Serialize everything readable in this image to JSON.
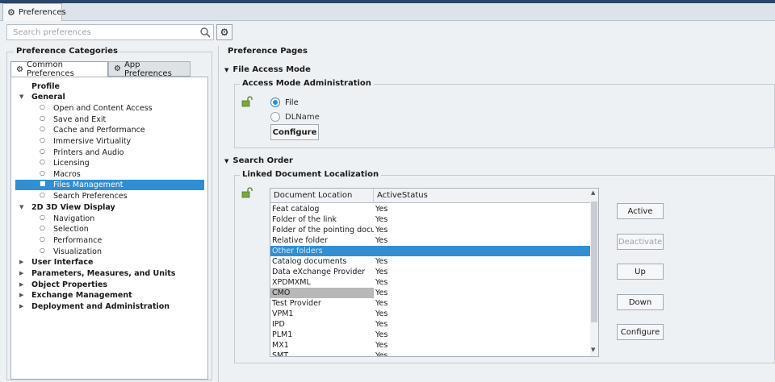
{
  "window": {
    "tab_label": "Preferences"
  },
  "search": {
    "placeholder": "Search preferences",
    "value": ""
  },
  "left": {
    "group_title": "Preference Categories",
    "tabs": [
      {
        "label": "Common Preferences"
      },
      {
        "label": "App Preferences"
      }
    ],
    "tree": [
      {
        "label": "Profile",
        "level": 0,
        "bold": true
      },
      {
        "label": "General",
        "level": 0,
        "bold": true,
        "expanded": true
      },
      {
        "label": "Open and Content Access",
        "level": 1
      },
      {
        "label": "Save and Exit",
        "level": 1
      },
      {
        "label": "Cache and Performance",
        "level": 1
      },
      {
        "label": "Immersive Virtuality",
        "level": 1
      },
      {
        "label": "Printers and Audio",
        "level": 1
      },
      {
        "label": "Licensing",
        "level": 1
      },
      {
        "label": "Macros",
        "level": 1
      },
      {
        "label": "Files Management",
        "level": 1,
        "selected": true
      },
      {
        "label": "Search Preferences",
        "level": 1
      },
      {
        "label": "2D 3D View Display",
        "level": 0,
        "bold": true,
        "expanded": true
      },
      {
        "label": "Navigation",
        "level": 1
      },
      {
        "label": "Selection",
        "level": 1
      },
      {
        "label": "Performance",
        "level": 1
      },
      {
        "label": "Visualization",
        "level": 1
      },
      {
        "label": "User Interface",
        "level": 0,
        "bold": true,
        "collapsed": true
      },
      {
        "label": "Parameters, Measures, and Units",
        "level": 0,
        "bold": true,
        "collapsed": true
      },
      {
        "label": "Object Properties",
        "level": 0,
        "bold": true,
        "collapsed": true
      },
      {
        "label": "Exchange Management",
        "level": 0,
        "bold": true,
        "collapsed": true
      },
      {
        "label": "Deployment and Administration",
        "level": 0,
        "bold": true,
        "collapsed": true
      }
    ]
  },
  "right": {
    "group_title": "Preference Pages",
    "file_access": {
      "title": "File Access Mode",
      "admin_title": "Access Mode Administration",
      "radio_file": "File",
      "radio_dlname": "DLName",
      "selected": "File",
      "configure_label": "Configure"
    },
    "search_order": {
      "title": "Search Order",
      "linked_title": "Linked Document Localization",
      "columns": [
        "Document Location",
        "ActiveStatus"
      ],
      "rows": [
        {
          "location": "Feat catalog",
          "status": "Yes"
        },
        {
          "location": "Folder of the link",
          "status": "Yes"
        },
        {
          "location": "Folder of the pointing docu",
          "status": "Yes"
        },
        {
          "location": "Relative folder",
          "status": "Yes"
        },
        {
          "location": "Other folders",
          "status": "",
          "selected": true
        },
        {
          "location": "Catalog documents",
          "status": "Yes"
        },
        {
          "location": "Data eXchange Provider",
          "status": "Yes"
        },
        {
          "location": "XPDMXML",
          "status": "Yes"
        },
        {
          "location": "CMO",
          "status": "Yes",
          "highlight": true
        },
        {
          "location": "Test Provider",
          "status": "Yes"
        },
        {
          "location": "VPM1",
          "status": "Yes"
        },
        {
          "location": "IPD",
          "status": "Yes"
        },
        {
          "location": "PLM1",
          "status": "Yes"
        },
        {
          "location": "MX1",
          "status": "Yes"
        },
        {
          "location": "SMT",
          "status": "Yes"
        }
      ],
      "buttons": {
        "active": "Active",
        "deactivate": "Deactivate",
        "up": "Up",
        "down": "Down",
        "configure": "Configure"
      }
    }
  },
  "colors": {
    "selection": "#2f8fd6",
    "window_bg": "#eef1f4",
    "title_strip": "#2a4566"
  }
}
